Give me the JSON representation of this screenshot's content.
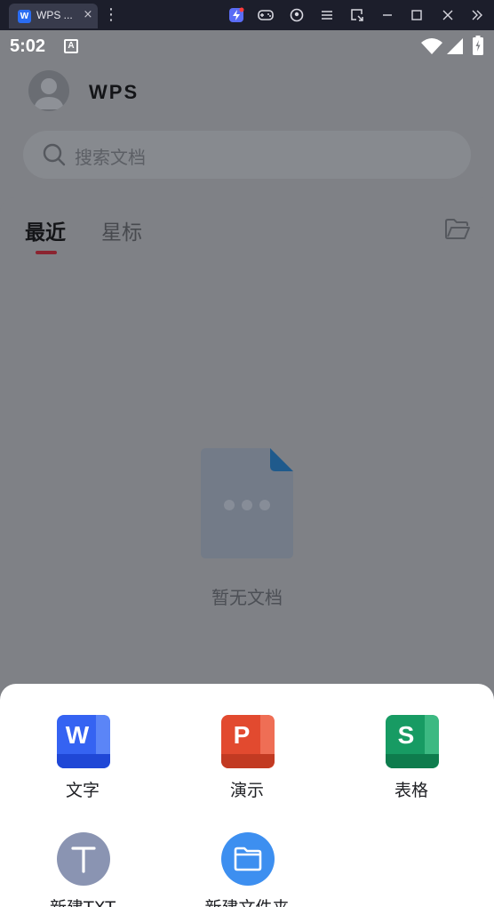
{
  "window": {
    "tab_title": "WPS ...",
    "tab_logo_letter": "W",
    "tab_close_glyph": "×",
    "more_glyph": "⋮",
    "toolbar_icons": [
      "bolt-icon",
      "gamepad-icon",
      "account-icon",
      "menu-icon",
      "resize-icon",
      "minimize-icon",
      "maximize-icon",
      "close-icon",
      "expand-icon"
    ]
  },
  "status_bar": {
    "time": "5:02",
    "notification_letter": "A"
  },
  "header": {
    "logo_text": "WPS"
  },
  "search": {
    "placeholder": "搜索文档"
  },
  "tabs": {
    "recent": "最近",
    "starred": "星标"
  },
  "empty_state": {
    "text": "暂无文档"
  },
  "sheet": {
    "actions": [
      {
        "label": "文字",
        "letter": "W",
        "color": "#2b5ff2"
      },
      {
        "label": "演示",
        "letter": "P",
        "color": "#e0452c"
      },
      {
        "label": "表格",
        "letter": "S",
        "color": "#149a60"
      },
      {
        "label": "新建TXT",
        "letter": "T",
        "color": "#8a94b2"
      },
      {
        "label": "新建文件夹",
        "icon": "folder-icon",
        "color": "#3b8ef0"
      }
    ]
  },
  "colors": {
    "accent_indicator": "#8b2430",
    "overlay": "#7f8186"
  }
}
